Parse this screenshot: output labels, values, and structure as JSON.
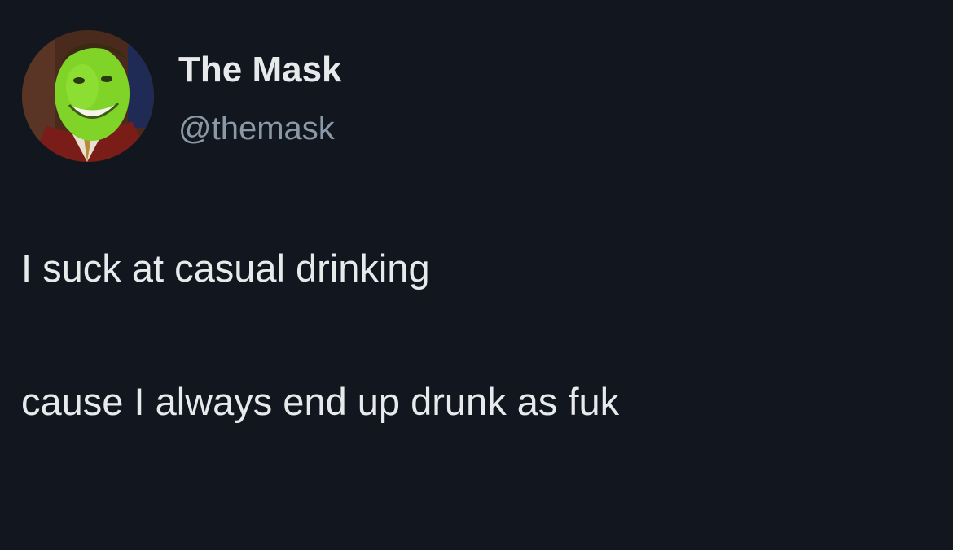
{
  "user": {
    "display_name": "The Mask",
    "handle": "@themask",
    "avatar_icon": "the-mask-green-face-avatar"
  },
  "tweet": {
    "lines": [
      "I suck at casual drinking",
      "cause I always end up drunk as fuk"
    ]
  },
  "colors": {
    "background": "#12161e",
    "primary_text": "#e7e9ea",
    "secondary_text": "#8b98a5",
    "mask_green": "#7fd427"
  }
}
